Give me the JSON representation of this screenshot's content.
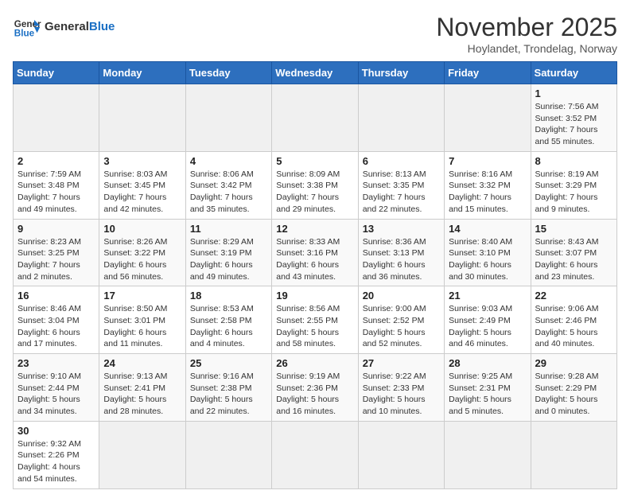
{
  "header": {
    "logo_general": "General",
    "logo_blue": "Blue",
    "title": "November 2025",
    "subtitle": "Hoylandet, Trondelag, Norway"
  },
  "weekdays": [
    "Sunday",
    "Monday",
    "Tuesday",
    "Wednesday",
    "Thursday",
    "Friday",
    "Saturday"
  ],
  "weeks": [
    [
      {
        "day": "",
        "info": ""
      },
      {
        "day": "",
        "info": ""
      },
      {
        "day": "",
        "info": ""
      },
      {
        "day": "",
        "info": ""
      },
      {
        "day": "",
        "info": ""
      },
      {
        "day": "",
        "info": ""
      },
      {
        "day": "1",
        "info": "Sunrise: 7:56 AM\nSunset: 3:52 PM\nDaylight: 7 hours\nand 55 minutes."
      }
    ],
    [
      {
        "day": "2",
        "info": "Sunrise: 7:59 AM\nSunset: 3:48 PM\nDaylight: 7 hours\nand 49 minutes."
      },
      {
        "day": "3",
        "info": "Sunrise: 8:03 AM\nSunset: 3:45 PM\nDaylight: 7 hours\nand 42 minutes."
      },
      {
        "day": "4",
        "info": "Sunrise: 8:06 AM\nSunset: 3:42 PM\nDaylight: 7 hours\nand 35 minutes."
      },
      {
        "day": "5",
        "info": "Sunrise: 8:09 AM\nSunset: 3:38 PM\nDaylight: 7 hours\nand 29 minutes."
      },
      {
        "day": "6",
        "info": "Sunrise: 8:13 AM\nSunset: 3:35 PM\nDaylight: 7 hours\nand 22 minutes."
      },
      {
        "day": "7",
        "info": "Sunrise: 8:16 AM\nSunset: 3:32 PM\nDaylight: 7 hours\nand 15 minutes."
      },
      {
        "day": "8",
        "info": "Sunrise: 8:19 AM\nSunset: 3:29 PM\nDaylight: 7 hours\nand 9 minutes."
      }
    ],
    [
      {
        "day": "9",
        "info": "Sunrise: 8:23 AM\nSunset: 3:25 PM\nDaylight: 7 hours\nand 2 minutes."
      },
      {
        "day": "10",
        "info": "Sunrise: 8:26 AM\nSunset: 3:22 PM\nDaylight: 6 hours\nand 56 minutes."
      },
      {
        "day": "11",
        "info": "Sunrise: 8:29 AM\nSunset: 3:19 PM\nDaylight: 6 hours\nand 49 minutes."
      },
      {
        "day": "12",
        "info": "Sunrise: 8:33 AM\nSunset: 3:16 PM\nDaylight: 6 hours\nand 43 minutes."
      },
      {
        "day": "13",
        "info": "Sunrise: 8:36 AM\nSunset: 3:13 PM\nDaylight: 6 hours\nand 36 minutes."
      },
      {
        "day": "14",
        "info": "Sunrise: 8:40 AM\nSunset: 3:10 PM\nDaylight: 6 hours\nand 30 minutes."
      },
      {
        "day": "15",
        "info": "Sunrise: 8:43 AM\nSunset: 3:07 PM\nDaylight: 6 hours\nand 23 minutes."
      }
    ],
    [
      {
        "day": "16",
        "info": "Sunrise: 8:46 AM\nSunset: 3:04 PM\nDaylight: 6 hours\nand 17 minutes."
      },
      {
        "day": "17",
        "info": "Sunrise: 8:50 AM\nSunset: 3:01 PM\nDaylight: 6 hours\nand 11 minutes."
      },
      {
        "day": "18",
        "info": "Sunrise: 8:53 AM\nSunset: 2:58 PM\nDaylight: 6 hours\nand 4 minutes."
      },
      {
        "day": "19",
        "info": "Sunrise: 8:56 AM\nSunset: 2:55 PM\nDaylight: 5 hours\nand 58 minutes."
      },
      {
        "day": "20",
        "info": "Sunrise: 9:00 AM\nSunset: 2:52 PM\nDaylight: 5 hours\nand 52 minutes."
      },
      {
        "day": "21",
        "info": "Sunrise: 9:03 AM\nSunset: 2:49 PM\nDaylight: 5 hours\nand 46 minutes."
      },
      {
        "day": "22",
        "info": "Sunrise: 9:06 AM\nSunset: 2:46 PM\nDaylight: 5 hours\nand 40 minutes."
      }
    ],
    [
      {
        "day": "23",
        "info": "Sunrise: 9:10 AM\nSunset: 2:44 PM\nDaylight: 5 hours\nand 34 minutes."
      },
      {
        "day": "24",
        "info": "Sunrise: 9:13 AM\nSunset: 2:41 PM\nDaylight: 5 hours\nand 28 minutes."
      },
      {
        "day": "25",
        "info": "Sunrise: 9:16 AM\nSunset: 2:38 PM\nDaylight: 5 hours\nand 22 minutes."
      },
      {
        "day": "26",
        "info": "Sunrise: 9:19 AM\nSunset: 2:36 PM\nDaylight: 5 hours\nand 16 minutes."
      },
      {
        "day": "27",
        "info": "Sunrise: 9:22 AM\nSunset: 2:33 PM\nDaylight: 5 hours\nand 10 minutes."
      },
      {
        "day": "28",
        "info": "Sunrise: 9:25 AM\nSunset: 2:31 PM\nDaylight: 5 hours\nand 5 minutes."
      },
      {
        "day": "29",
        "info": "Sunrise: 9:28 AM\nSunset: 2:29 PM\nDaylight: 5 hours\nand 0 minutes."
      }
    ],
    [
      {
        "day": "30",
        "info": "Sunrise: 9:32 AM\nSunset: 2:26 PM\nDaylight: 4 hours\nand 54 minutes."
      },
      {
        "day": "",
        "info": ""
      },
      {
        "day": "",
        "info": ""
      },
      {
        "day": "",
        "info": ""
      },
      {
        "day": "",
        "info": ""
      },
      {
        "day": "",
        "info": ""
      },
      {
        "day": "",
        "info": ""
      }
    ]
  ]
}
